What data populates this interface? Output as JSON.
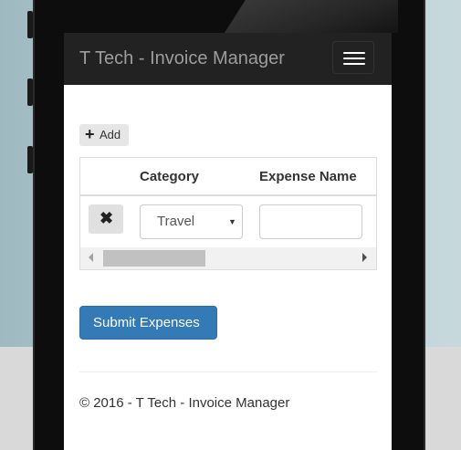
{
  "navbar": {
    "brand": "T Tech - Invoice Manager",
    "toggle_icon": "hamburger-menu-icon"
  },
  "toolbar": {
    "add_icon": "plus-icon",
    "add_label": "Add"
  },
  "expense_table": {
    "columns": [
      "",
      "Category",
      "Expense Name"
    ],
    "rows": [
      {
        "delete_icon": "close-icon",
        "category": "Travel",
        "expense_name": ""
      }
    ]
  },
  "submit_label": "Submit Expenses",
  "footer": "© 2016 - T Tech - Invoice Manager",
  "colors": {
    "navbar_bg": "#222222",
    "brand_text": "#9d9d9d",
    "primary": "#337ab7"
  }
}
